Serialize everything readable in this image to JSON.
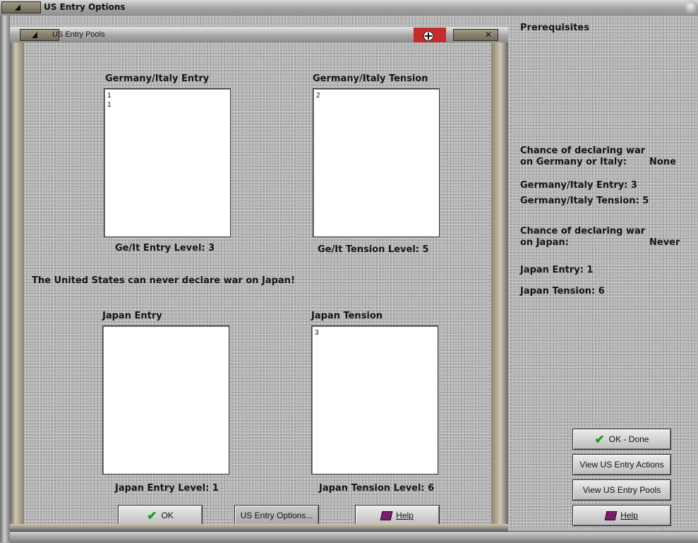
{
  "window": {
    "title": "US Entry Options"
  },
  "dialog": {
    "title": "US Entry Pools",
    "germany_entry": {
      "label": "Germany/Italy Entry",
      "items": [
        "1",
        "1"
      ],
      "level": "Ge/It Entry Level: 3"
    },
    "germany_tension": {
      "label": "Germany/Italy Tension",
      "items": [
        "2"
      ],
      "level": "Ge/It Tension Level: 5"
    },
    "warning": "The United States can never declare war on Japan!",
    "japan_entry": {
      "label": "Japan Entry",
      "items": [],
      "level": "Japan Entry Level: 1"
    },
    "japan_tension": {
      "label": "Japan Tension",
      "items": [
        "3"
      ],
      "level": "Japan Tension Level: 6"
    },
    "buttons": {
      "ok": "OK",
      "options": "US Entry Options...",
      "help": "Help"
    }
  },
  "prereq": {
    "heading": "Prerequisites",
    "chance_ger_line1": "Chance of declaring war",
    "chance_ger_line2": "on Germany or Italy:",
    "chance_ger_value": "None",
    "ger_entry": "Germany/Italy Entry: 3",
    "ger_tension": "Germany/Italy Tension: 5",
    "chance_jap_line1": "Chance of declaring war",
    "chance_jap_line2": "on Japan:",
    "chance_jap_value": "Never",
    "jap_entry": "Japan Entry: 1",
    "jap_tension": "Japan Tension: 6"
  },
  "right_buttons": {
    "ok_done": "OK - Done",
    "view_actions": "View US Entry Actions",
    "view_pools": "View US Entry Pools",
    "help": "Help"
  },
  "colors": {
    "check": "#1a9a1a",
    "flag": "#c42b2b",
    "book": "#7a1d6a"
  },
  "icons": [
    "checkmark-icon",
    "help-book-icon",
    "flag-icon",
    "close-icon",
    "minimize-icon"
  ]
}
